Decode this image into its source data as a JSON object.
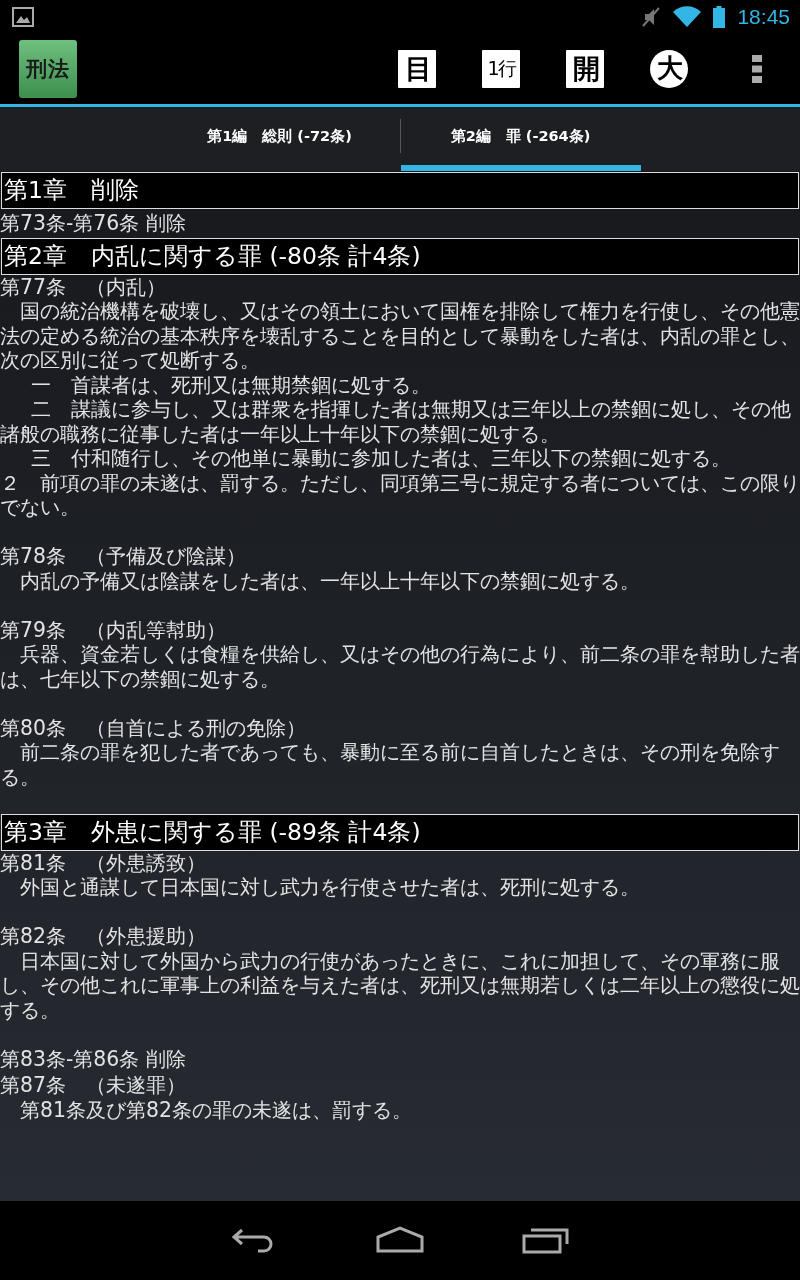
{
  "status_bar": {
    "time": "18:45"
  },
  "action_bar": {
    "app_icon": "刑法",
    "actions": [
      {
        "label": "目",
        "kind": "square"
      },
      {
        "label": "1行",
        "kind": "square"
      },
      {
        "label": "開",
        "kind": "square"
      },
      {
        "label": "大",
        "kind": "circle"
      }
    ]
  },
  "tabs": [
    {
      "label": "第1編　総則 (-72条)",
      "selected": false
    },
    {
      "label": "第2編　罪 (-264条)",
      "selected": true
    }
  ],
  "content": [
    {
      "kind": "chapter",
      "text": "第1章　削除"
    },
    {
      "kind": "line",
      "text": "第73条-第76条 削除"
    },
    {
      "kind": "chapter",
      "text": "第2章　内乱に関する罪 (-80条  計4条)"
    },
    {
      "kind": "article",
      "heading": "第77条　（内乱）",
      "paragraphs": [
        {
          "kind": "para",
          "text": "　国の統治機構を破壊し、又はその領土において国権を排除して権力を行使し、その他憲法の定める統治の基本秩序を壊乱することを目的として暴動をした者は、内乱の罪とし、次の区別に従って処断する。"
        },
        {
          "kind": "item",
          "text": "一　首謀者は、死刑又は無期禁錮に処する。"
        },
        {
          "kind": "item",
          "text": "二　謀議に参与し、又は群衆を指揮した者は無期又は三年以上の禁錮に処し、その他諸般の職務に従事した者は一年以上十年以下の禁錮に処する。"
        },
        {
          "kind": "item",
          "text": "三　付和随行し、その他単に暴動に参加した者は、三年以下の禁錮に処する。"
        },
        {
          "kind": "para",
          "text": "２　前項の罪の未遂は、罰する。ただし、同項第三号に規定する者については、この限りでない。"
        }
      ]
    },
    {
      "kind": "article",
      "heading": "第78条　（予備及び陰謀）",
      "paragraphs": [
        {
          "kind": "para",
          "text": "　内乱の予備又は陰謀をした者は、一年以上十年以下の禁錮に処する。"
        }
      ]
    },
    {
      "kind": "article",
      "heading": "第79条　（内乱等幇助）",
      "paragraphs": [
        {
          "kind": "para",
          "text": "　兵器、資金若しくは食糧を供給し、又はその他の行為により、前二条の罪を幇助した者は、七年以下の禁錮に処する。"
        }
      ]
    },
    {
      "kind": "article",
      "heading": "第80条　（自首による刑の免除）",
      "paragraphs": [
        {
          "kind": "para",
          "text": "　前二条の罪を犯した者であっても、暴動に至る前に自首したときは、その刑を免除する。"
        }
      ]
    },
    {
      "kind": "chapter",
      "text": "第3章　外患に関する罪 (-89条  計4条)"
    },
    {
      "kind": "article",
      "heading": "第81条　（外患誘致）",
      "paragraphs": [
        {
          "kind": "para",
          "text": "　外国と通謀して日本国に対し武力を行使させた者は、死刑に処する。"
        }
      ]
    },
    {
      "kind": "article",
      "heading": "第82条　（外患援助）",
      "paragraphs": [
        {
          "kind": "para",
          "text": "　日本国に対して外国から武力の行使があったときに、これに加担して、その軍務に服し、その他これに軍事上の利益を与えた者は、死刑又は無期若しくは二年以上の懲役に処する。"
        }
      ]
    },
    {
      "kind": "line",
      "text": "第83条-第86条 削除"
    },
    {
      "kind": "article",
      "heading": "第87条　（未遂罪）",
      "paragraphs": [
        {
          "kind": "para",
          "text": "　第81条及び第82条の罪の未遂は、罰する。"
        }
      ]
    }
  ]
}
